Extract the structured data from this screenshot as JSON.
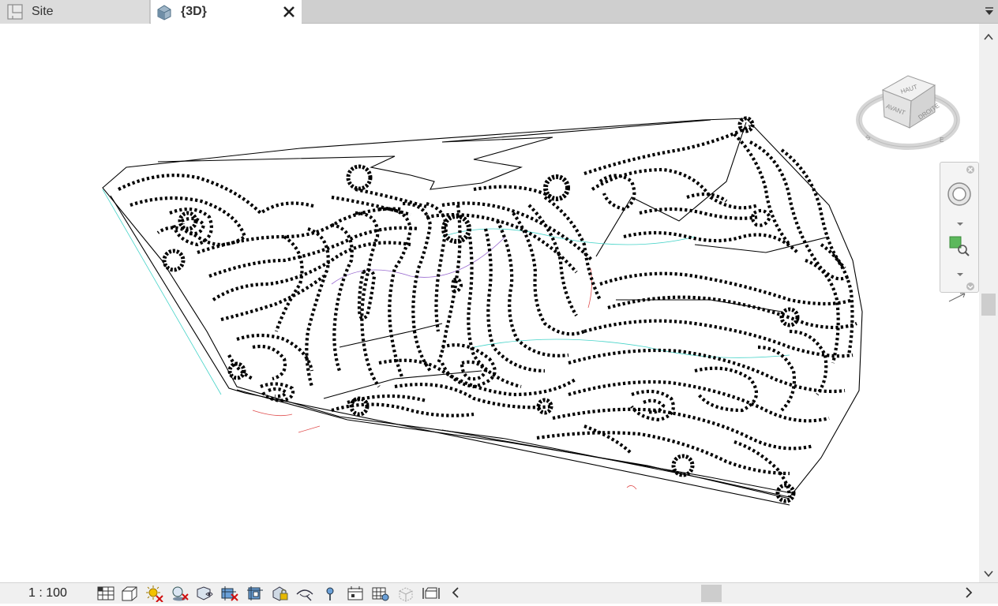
{
  "tabs": [
    {
      "label": "Site",
      "icon": "floor-plan-icon",
      "active": false
    },
    {
      "label": "{3D}",
      "icon": "3d-house-icon",
      "active": true
    }
  ],
  "viewcube": {
    "top": "HAUT",
    "front": "AVANT",
    "right": "DROITE",
    "compass_s": "S",
    "compass_e": "E"
  },
  "status": {
    "scale": "1 : 100",
    "buttons": [
      "detail-level-icon",
      "visual-style-icon",
      "sun-path-icon",
      "shadows-icon",
      "show-rendering-icon",
      "crop-view-icon",
      "show-crop-region-icon",
      "unlock-3d-view-icon",
      "temporary-hide-isolate-icon",
      "reveal-hidden-elements-icon",
      "worksharing-display-icon",
      "temporary-view-properties-icon",
      "analytical-model-icon",
      "highlight-displacement-icon"
    ]
  },
  "colors": {
    "tabbar": "#cfcfcf",
    "line": "#000000",
    "accent_cyan": "#45d3c8",
    "accent_red": "#e05050"
  }
}
